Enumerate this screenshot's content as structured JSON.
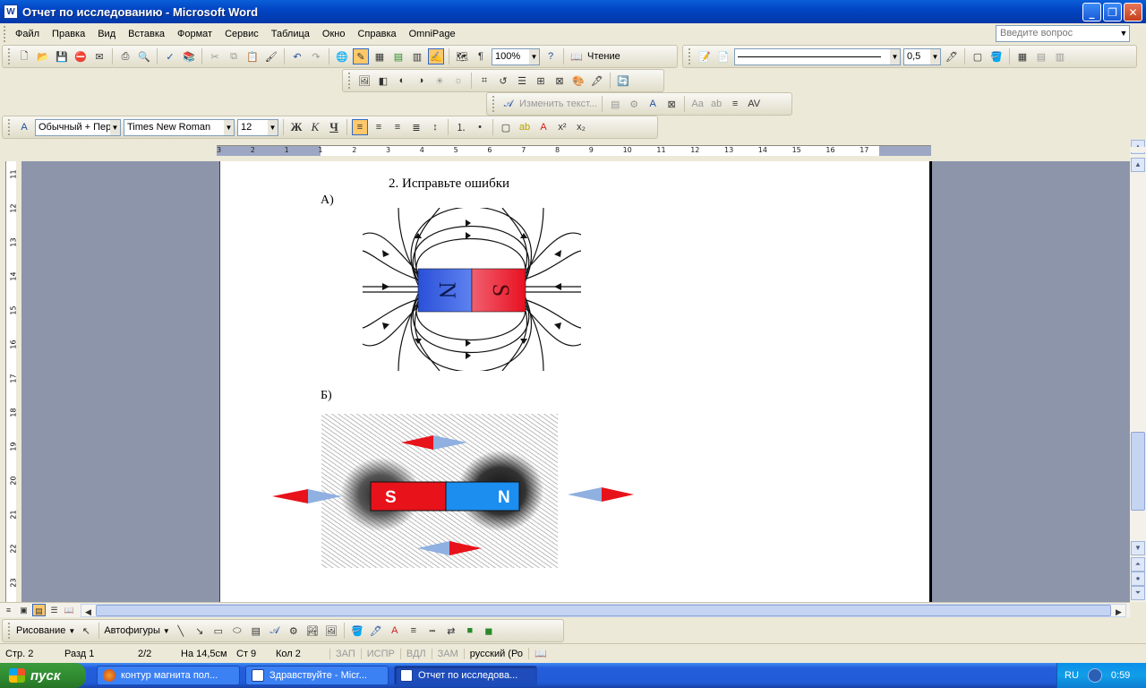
{
  "window": {
    "title": "Отчет по исследованию - Microsoft Word",
    "app_icon": "W"
  },
  "menu": [
    "Файл",
    "Правка",
    "Вид",
    "Вставка",
    "Формат",
    "Сервис",
    "Таблица",
    "Окно",
    "Справка",
    "OmniPage"
  ],
  "help_search": {
    "placeholder": "Введите вопрос"
  },
  "standard_toolbar": {
    "zoom": "100%",
    "reading_label": "Чтение"
  },
  "drawing_toolbar_top": {
    "line_width": "0,5"
  },
  "picture_toolbar": {
    "edit_text": "Изменить текст..."
  },
  "formatting_toolbar": {
    "style": "Обычный + Пер",
    "font": "Times New Roman",
    "size": "12",
    "bold": "Ж",
    "italic": "К",
    "underline": "Ч"
  },
  "ruler_h_labels": [
    "3",
    "2",
    "1",
    "1",
    "2",
    "3",
    "4",
    "5",
    "6",
    "7",
    "8",
    "9",
    "10",
    "11",
    "12",
    "13",
    "14",
    "15",
    "16",
    "17"
  ],
  "ruler_v_labels": [
    "11",
    "12",
    "13",
    "14",
    "15",
    "16",
    "17",
    "18",
    "19",
    "20",
    "21",
    "22",
    "23"
  ],
  "document": {
    "heading": "2.   Исправьте ошибки",
    "label_a": "А)",
    "label_b": "Б)",
    "magnet_a": {
      "left_pole": "N",
      "right_pole": "S"
    },
    "magnet_b": {
      "left_pole": "S",
      "right_pole": "N"
    }
  },
  "drawing_bar": {
    "draw_menu": "Рисование",
    "autoshapes": "Автофигуры"
  },
  "status": {
    "page": "Стр. 2",
    "section": "Разд 1",
    "pages": "2/2",
    "at": "На 14,5см",
    "line": "Ст 9",
    "col": "Кол 2",
    "rec": "ЗАП",
    "trk": "ИСПР",
    "ext": "ВДЛ",
    "ovr": "ЗАМ",
    "lang": "русский (Ро"
  },
  "taskbar": {
    "start": "пуск",
    "tasks": [
      "контур магнита пол...",
      "Здравствуйте - Micr...",
      "Отчет по исследова..."
    ],
    "lang": "RU",
    "clock": "0:59"
  },
  "colors": {
    "north_blue": "#2c5fe8",
    "south_red": "#e8202a",
    "title_blue": "#0245c4"
  }
}
